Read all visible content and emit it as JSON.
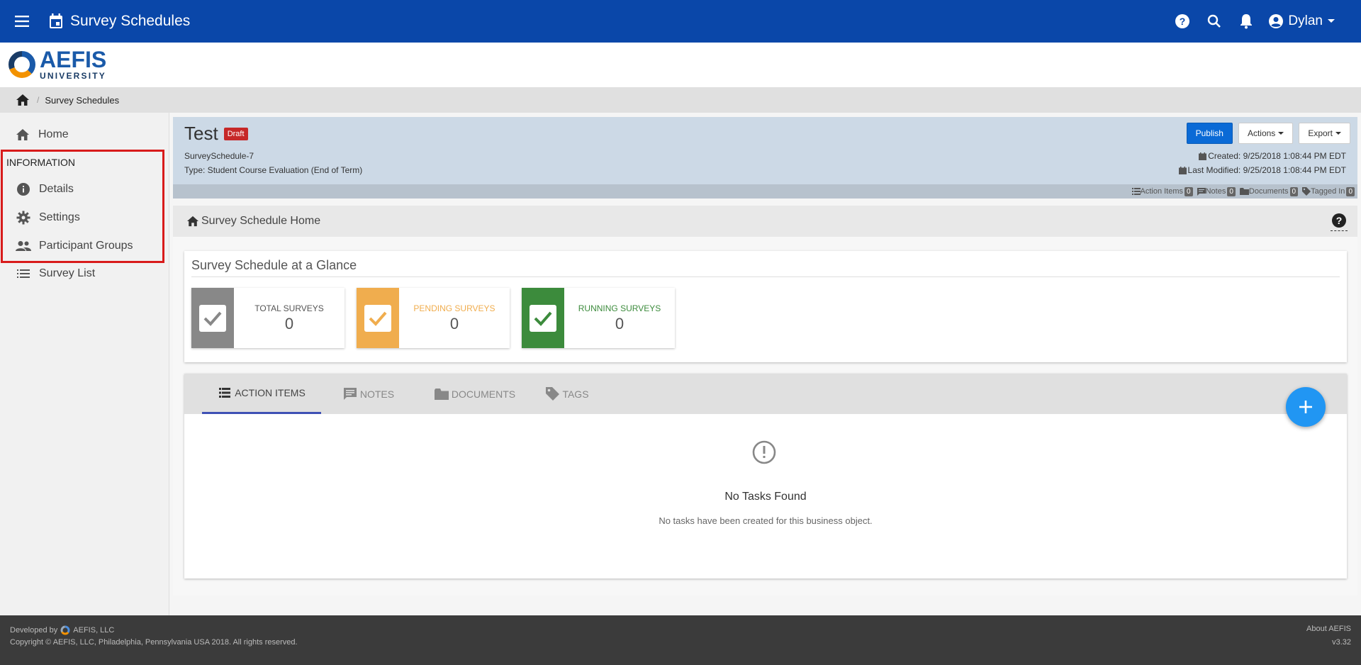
{
  "topbar": {
    "title": "Survey Schedules",
    "user": "Dylan"
  },
  "logo": {
    "main": "AEFIS",
    "sub": "UNIVERSITY"
  },
  "breadcrumb": {
    "current": "Survey Schedules"
  },
  "sidebar": {
    "home": "Home",
    "section_title": "INFORMATION",
    "items": [
      {
        "label": "Details",
        "icon": "info-icon"
      },
      {
        "label": "Settings",
        "icon": "gear-icon"
      },
      {
        "label": "Participant Groups",
        "icon": "people-icon"
      },
      {
        "label": "Survey List",
        "icon": "list-icon"
      }
    ]
  },
  "header": {
    "title": "Test",
    "badge": "Draft",
    "id": "SurveySchedule-7",
    "type": "Type: Student Course Evaluation (End of Term)",
    "publish": "Publish",
    "actions": "Actions",
    "export": "Export",
    "created": "Created: 9/25/2018 1:08:44 PM EDT",
    "modified": "Last Modified: 9/25/2018 1:08:44 PM EDT",
    "counters": [
      {
        "label": "Action Items",
        "count": "0"
      },
      {
        "label": "Notes",
        "count": "0"
      },
      {
        "label": "Documents",
        "count": "0"
      },
      {
        "label": "Tagged In",
        "count": "0"
      }
    ]
  },
  "subbar": {
    "title": "Survey Schedule Home"
  },
  "glance": {
    "title": "Survey Schedule at a Glance",
    "stats": [
      {
        "label": "TOTAL SURVEYS",
        "value": "0",
        "color": "#888888"
      },
      {
        "label": "PENDING SURVEYS",
        "value": "0",
        "color": "#f0ad4e"
      },
      {
        "label": "RUNNING SURVEYS",
        "value": "0",
        "color": "#3c8b3c"
      }
    ]
  },
  "tabs": {
    "items": [
      {
        "label": "ACTION ITEMS"
      },
      {
        "label": "NOTES"
      },
      {
        "label": "DOCUMENTS"
      },
      {
        "label": "TAGS"
      }
    ],
    "empty_title": "No Tasks Found",
    "empty_desc": "No tasks have been created for this business object."
  },
  "footer": {
    "developed_by": "Developed by",
    "company": "AEFIS, LLC",
    "copyright": "Copyright © AEFIS, LLC, Philadelphia, Pennsylvania USA 2018. All rights reserved.",
    "about": "About AEFIS",
    "version": "v3.32"
  }
}
